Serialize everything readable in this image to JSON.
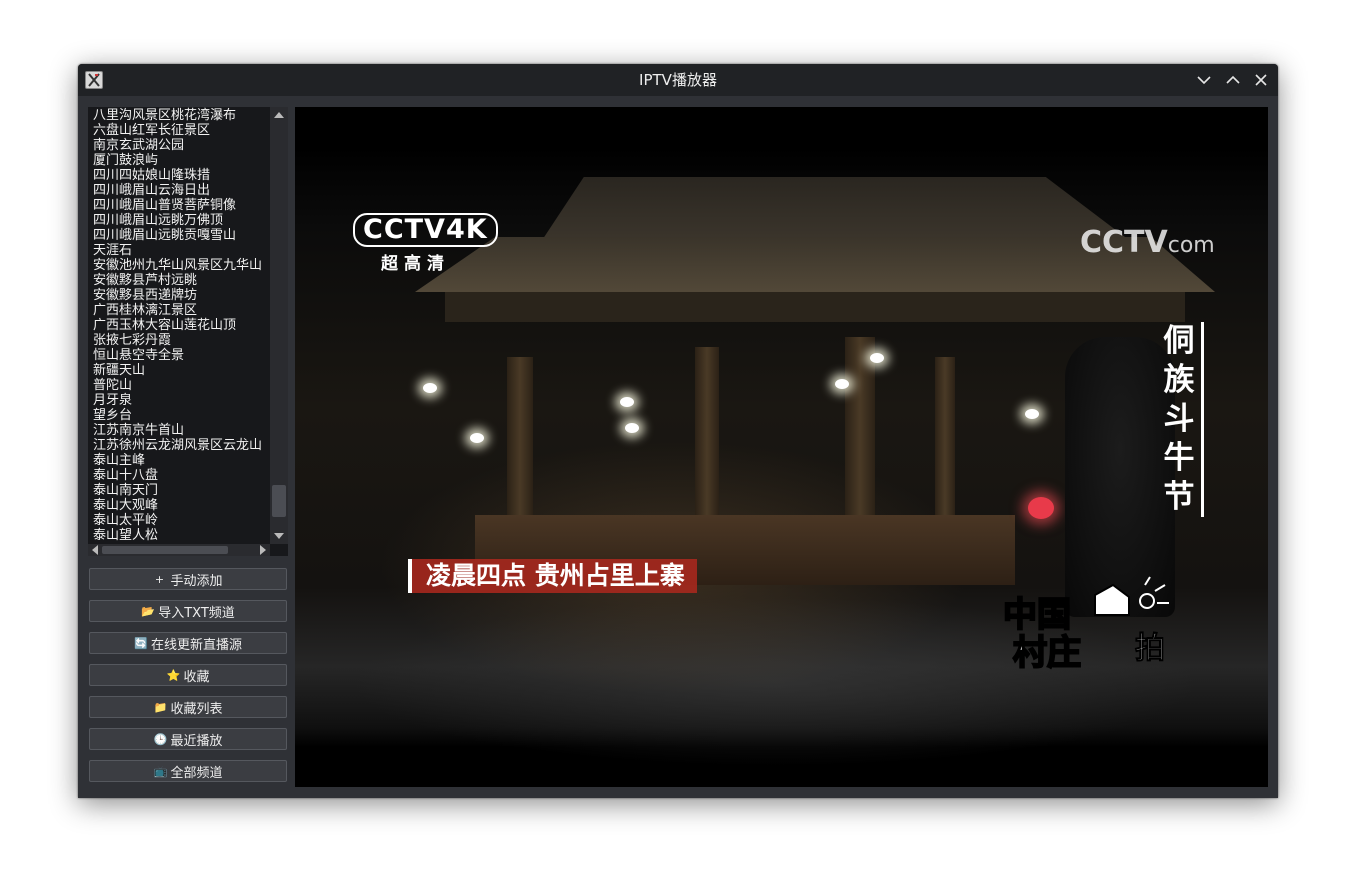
{
  "window": {
    "title": "IPTV播放器",
    "controls": [
      "minimize",
      "maximize",
      "close"
    ]
  },
  "channel_list": {
    "items": [
      "八里沟风景区桃花湾瀑布",
      "六盘山红军长征景区",
      "南京玄武湖公园",
      "厦门鼓浪屿",
      "四川四姑娘山隆珠措",
      "四川峨眉山云海日出",
      "四川峨眉山普贤菩萨铜像",
      "四川峨眉山远眺万佛顶",
      "四川峨眉山远眺贡嘎雪山",
      "天涯石",
      "安徽池州九华山风景区九华山",
      "安徽黟县芦村远眺",
      "安徽黟县西递牌坊",
      "广西桂林漓江景区",
      "广西玉林大容山莲花山顶",
      "张掖七彩丹霞",
      "恒山悬空寺全景",
      "新疆天山",
      "普陀山",
      "月牙泉",
      "望乡台",
      "江苏南京牛首山",
      "江苏徐州云龙湖风景区云龙山",
      "泰山主峰",
      "泰山十八盘",
      "泰山南天门",
      "泰山大观峰",
      "泰山太平岭",
      "泰山望人松"
    ]
  },
  "buttons": [
    {
      "icon": "plus-icon",
      "glyph": "+",
      "label": "手动添加"
    },
    {
      "icon": "folder-icon",
      "glyph": "📂",
      "label": "导入TXT频道"
    },
    {
      "icon": "refresh-icon",
      "glyph": "🔄",
      "label": "在线更新直播源"
    },
    {
      "icon": "star-icon",
      "glyph": "⭐",
      "label": "收藏"
    },
    {
      "icon": "folder-icon",
      "glyph": "📁",
      "label": "收藏列表"
    },
    {
      "icon": "clock-icon",
      "glyph": "🕒",
      "label": "最近播放"
    },
    {
      "icon": "tv-icon",
      "glyph": "📺",
      "label": "全部频道"
    }
  ],
  "video": {
    "channel_logo": "CCTV4K",
    "channel_logo_sub": "超高清",
    "watermark": "CCTV",
    "watermark_suffix": "com",
    "vertical_title": "侗族斗牛节",
    "caption": "凌晨四点 贵州占里上寨",
    "program_logo_line1": "中国",
    "program_logo_line2": "村庄",
    "program_logo_line3": "拍"
  },
  "colors": {
    "caption_bg": "#aa281e",
    "window_bg": "#2b2d31",
    "list_bg": "#17181b"
  }
}
